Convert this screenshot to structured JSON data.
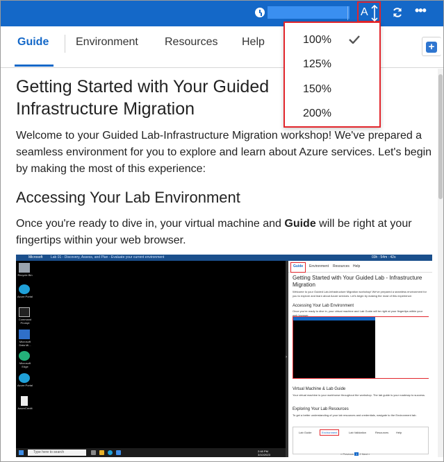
{
  "topbar": {
    "font_size_label": "A",
    "colors": {
      "bar": "#1468c8",
      "highlight": "#e2252b"
    }
  },
  "tabs": [
    {
      "label": "Guide",
      "active": true
    },
    {
      "label": "Environment",
      "active": false
    },
    {
      "label": "Resources",
      "active": false
    },
    {
      "label": "Help",
      "active": false
    }
  ],
  "zoom_menu": {
    "options": [
      "100%",
      "125%",
      "150%",
      "200%"
    ],
    "selected": "100%"
  },
  "guide": {
    "title": "Getting Started with Your Guided Lab - Infrastructure Migration",
    "title_line1": "Getting Started with Your Guided",
    "title_line2": "Infrastructure Migration",
    "intro": "Welcome to your Guided Lab-Infrastructure Migration workshop! We've prepared a seamless environment for you to explore and learn about Azure services. Let's begin by making the most of this experience:",
    "section_heading": "Accessing Your Lab Environment",
    "section_text_before": "Once you're ready to dive in, your virtual machine and ",
    "section_text_bold": "Guide",
    "section_text_after": " will be right at your fingertips within your web browser."
  },
  "embedded_screenshot": {
    "vm_title": "Lab 01 - Discovery, Assess, and Plan - Evaluate your current environment",
    "brand": "Microsoft",
    "timer": "03h : 54m : 42s",
    "desktop_icons": [
      "Recycle Bin",
      "Azure Portal",
      "Command Prompt",
      "Microsoft Data Mi...",
      "Microsoft Edge",
      "Azure Portal",
      "AzureCredit"
    ],
    "taskbar_search": "Type here to search",
    "clock_time": "2:48 PM",
    "clock_date": "3/10/2023",
    "mini_tabs": [
      "Guide",
      "Environment",
      "Resources",
      "Help"
    ],
    "mini_title": "Getting Started with Your Guided Lab - Infrastructure Migration",
    "mini_intro": "Welcome to your Guided Lab-Infrastructure Migration workshop! We've prepared a seamless environment for you to explore and learn about Azure services. Let's begin by making the most of this experience:",
    "mini_h2": "Accessing Your Lab Environment",
    "mini_p2": "Once you're ready to dive in, your virtual machine and Lab Guide will be right at your fingertips within your web browser.",
    "mini_h3": "Virtual Machine & Lab Guide",
    "mini_p3": "Your virtual machine is your workhorse throughout the workshop. The lab guide is your roadmap to success.",
    "mini_h4": "Exploring Your Lab Resources",
    "mini_p4": "To get a better understanding of your lab resources and credentials, navigate to the Environment tab.",
    "mini_bottom_tabs": [
      "Lab Guide",
      "Environment",
      "Lab Validation",
      "Resources",
      "Help"
    ],
    "pager_prev": "« Previous",
    "pager_pages": [
      "1",
      "2"
    ],
    "pager_next": "Next »"
  }
}
